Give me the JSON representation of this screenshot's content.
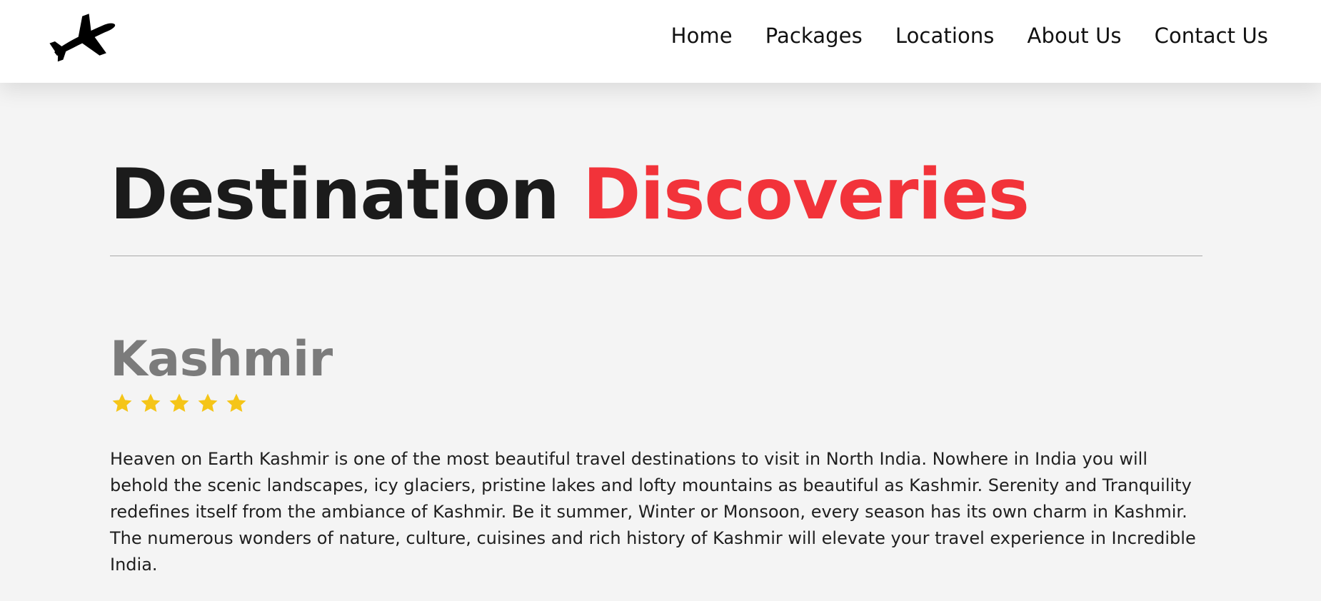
{
  "header": {
    "logo_icon": "airplane-icon",
    "nav": [
      {
        "label": "Home"
      },
      {
        "label": "Packages"
      },
      {
        "label": "Locations"
      },
      {
        "label": "About Us"
      },
      {
        "label": "Contact Us"
      }
    ]
  },
  "main": {
    "title_part1": "Destination",
    "title_part2": "Discoveries",
    "location": {
      "name": "Kashmir",
      "rating": 5,
      "rating_icon": "star-icon",
      "description": "Heaven on Earth Kashmir is one of the most beautiful travel destinations to visit in North India. Nowhere in India you will behold the scenic landscapes, icy glaciers, pristine lakes and lofty mountains as beautiful as Kashmir. Serenity and Tranquility redefines itself from the ambiance of Kashmir. Be it summer, Winter or Monsoon, every season has its own charm in Kashmir. The numerous wonders of nature, culture, cuisines and rich history of Kashmir will elevate your travel experience in Incredible India."
    }
  },
  "colors": {
    "accent": "#f2333a",
    "star": "#f5c518",
    "heading_dark": "#1b1b1b",
    "heading_gray": "#7b7b7b",
    "background": "#f4f4f4"
  }
}
